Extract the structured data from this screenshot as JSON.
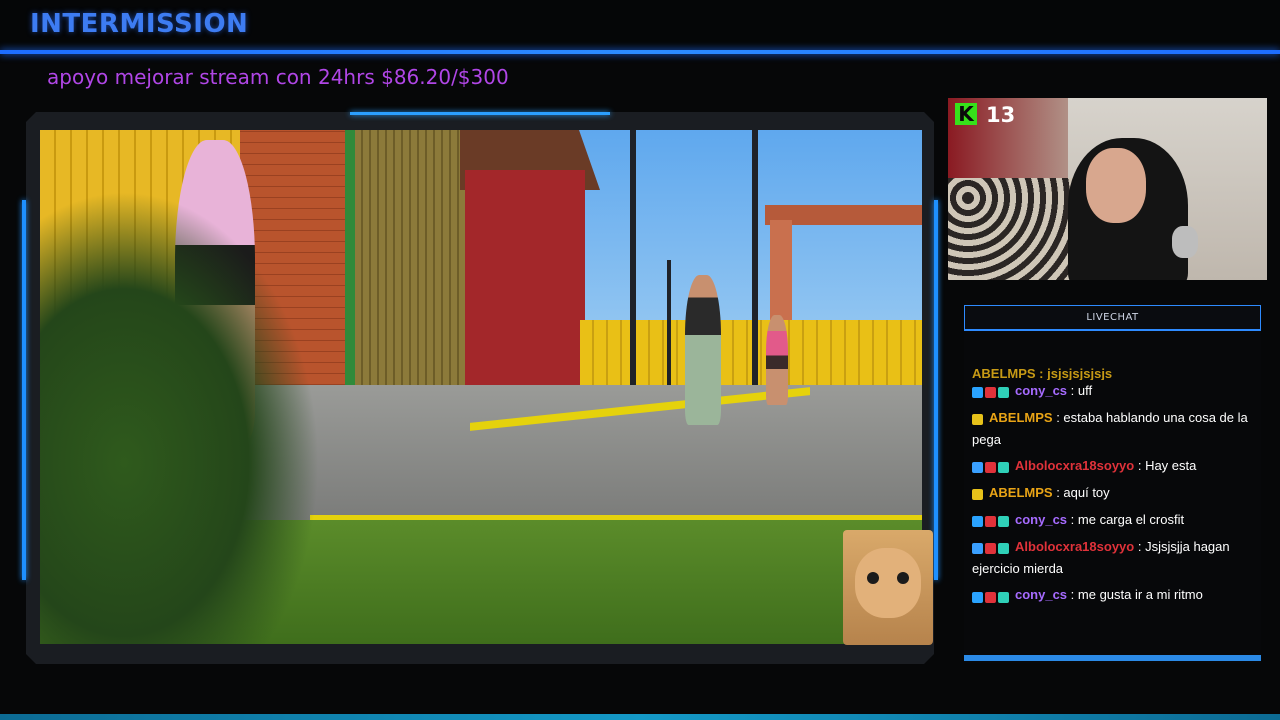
{
  "header": {
    "title": "INTERMISSION",
    "goal_text": "apoyo mejorar stream con 24hrs $86.20/$300"
  },
  "webcam": {
    "platform_badge": "K",
    "viewer_count": "13"
  },
  "chat": {
    "header_label": "LIVECHAT",
    "cut_off_line": "ABELMPS : jsjsjsjsjsjs",
    "messages": [
      {
        "user": "cony_cs",
        "user_color": "#a66bff",
        "badges": [
          "verified-icon",
          "heart-icon",
          "sub-icon"
        ],
        "text": ": uff"
      },
      {
        "user": "ABELMPS",
        "user_color": "#e9a416",
        "badges": [
          "cat-icon"
        ],
        "text": ": estaba hablando una cosa de la pega"
      },
      {
        "user": "Albolocxra18soyyo",
        "user_color": "#e0323a",
        "badges": [
          "cube-icon",
          "heart-icon",
          "sub-icon"
        ],
        "text": ": Hay esta"
      },
      {
        "user": "ABELMPS",
        "user_color": "#e9a416",
        "badges": [
          "cat-icon"
        ],
        "text": ": aquí toy"
      },
      {
        "user": "cony_cs",
        "user_color": "#a66bff",
        "badges": [
          "verified-icon",
          "heart-icon",
          "sub-icon"
        ],
        "text": ": me carga el crosfit"
      },
      {
        "user": "Albolocxra18soyyo",
        "user_color": "#e0323a",
        "badges": [
          "cube-icon",
          "heart-icon",
          "sub-icon"
        ],
        "text": ": Jsjsjsjja hagan ejercicio mierda"
      },
      {
        "user": "cony_cs",
        "user_color": "#a66bff",
        "badges": [
          "verified-icon",
          "heart-icon",
          "sub-icon"
        ],
        "text": ": me gusta ir a mi ritmo"
      }
    ]
  },
  "colors": {
    "accent_blue": "#2b8ae6",
    "title_blue": "#3d7cf2",
    "goal_purple": "#b046e6",
    "kick_green": "#37e11a"
  }
}
